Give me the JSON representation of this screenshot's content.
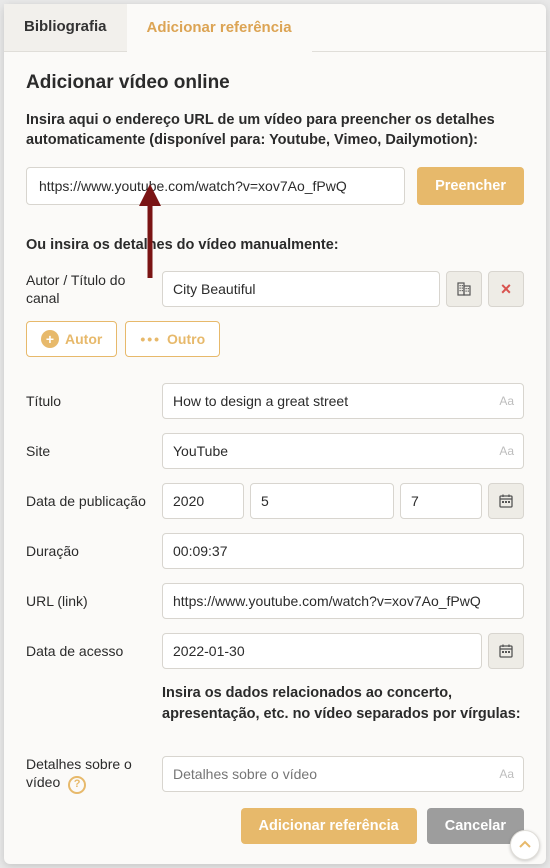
{
  "tabs": {
    "bibliography": "Bibliografia",
    "add_reference": "Adicionar referência"
  },
  "heading": "Adicionar vídeo online",
  "url_instruction": "Insira aqui o endereço URL de um vídeo para preencher os detalhes automaticamente (disponível para: Youtube, Vimeo, Dailymotion):",
  "url_value": "https://www.youtube.com/watch?v=xov7Ao_fPwQ",
  "fill_button": "Preencher",
  "manual_instruction": "Ou insira os detalhes do vídeo manualmente:",
  "labels": {
    "author": "Autor / Título do canal",
    "title": "Título",
    "site": "Site",
    "pub_date": "Data de publicação",
    "duration": "Duração",
    "url": "URL (link)",
    "access_date": "Data de acesso",
    "details": "Detalhes sobre o vídeo"
  },
  "values": {
    "author": "City Beautiful",
    "title": "How to design a great street",
    "site": "YouTube",
    "pub_year": "2020",
    "pub_month": "5",
    "pub_day": "7",
    "duration": "00:09:37",
    "url": "https://www.youtube.com/watch?v=xov7Ao_fPwQ",
    "access_date": "2022-01-30"
  },
  "buttons": {
    "add_author": "Autor",
    "other": "Outro",
    "add_reference": "Adicionar referência",
    "cancel": "Cancelar"
  },
  "concert_msg": "Insira os dados relacionados ao concerto, apresentação, etc. no vídeo separados por vírgulas:",
  "details_placeholder": "Detalhes sobre o vídeo",
  "aa_hint": "Aa"
}
